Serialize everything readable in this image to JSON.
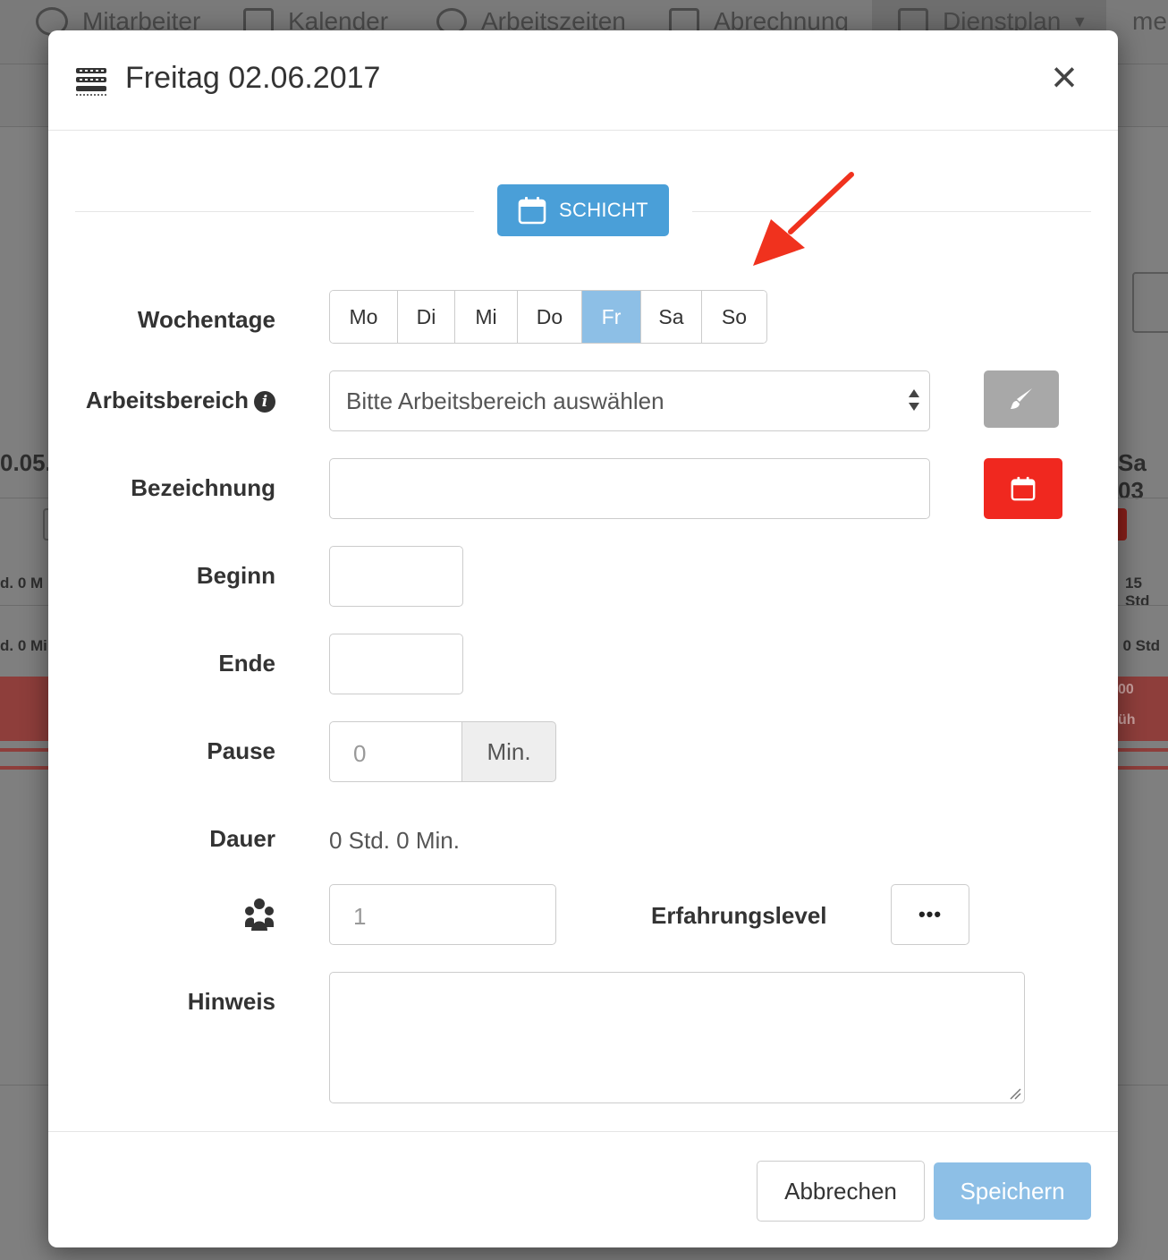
{
  "background": {
    "nav": [
      {
        "label": "Mitarbeiter",
        "icon": "people-icon"
      },
      {
        "label": "Kalender",
        "icon": "calendar-31-icon"
      },
      {
        "label": "Arbeitszeiten",
        "icon": "clock-icon"
      },
      {
        "label": "Abrechnung",
        "icon": "calculator-icon"
      },
      {
        "label": "Dienstplan",
        "icon": "roster-icon"
      },
      {
        "label": "me",
        "icon": ""
      }
    ],
    "left_date": "0.05.",
    "right_date": "Sa 03",
    "left_hours_1": "d. 0 M",
    "left_hours_2": "d. 0 Mi",
    "right_hours_1": "15 Std",
    "right_hours_2": ". 0 Std",
    "right_shift_1": "00",
    "right_shift_2": "üh"
  },
  "modal": {
    "title": "Freitag 02.06.2017",
    "close_label": "×",
    "section_button": "SCHICHT",
    "labels": {
      "wochentage": "Wochentage",
      "arbeitsbereich": "Arbeitsbereich",
      "bezeichnung": "Bezeichnung",
      "beginn": "Beginn",
      "ende": "Ende",
      "pause": "Pause",
      "dauer": "Dauer",
      "hinweis": "Hinweis",
      "erfahrungslevel": "Erfahrungslevel"
    },
    "weekdays": [
      {
        "label": "Mo",
        "active": false
      },
      {
        "label": "Di",
        "active": false
      },
      {
        "label": "Mi",
        "active": false
      },
      {
        "label": "Do",
        "active": false
      },
      {
        "label": "Fr",
        "active": true
      },
      {
        "label": "Sa",
        "active": false
      },
      {
        "label": "So",
        "active": false
      }
    ],
    "arbeitsbereich_select": "Bitte Arbeitsbereich auswählen",
    "bezeichnung_value": "",
    "beginn_value": "",
    "ende_value": "",
    "pause_placeholder": "0",
    "pause_unit": "Min.",
    "dauer_value": "0 Std. 0 Min.",
    "count_placeholder": "1",
    "erfahrungslevel_button": "•••",
    "hinweis_value": "",
    "buttons": {
      "cancel": "Abbrechen",
      "save": "Speichern"
    },
    "colors": {
      "primary": "#4a9fd8",
      "primary_disabled": "#8dbfe6",
      "danger": "#f0281f",
      "arrow": "#f0321e"
    }
  }
}
